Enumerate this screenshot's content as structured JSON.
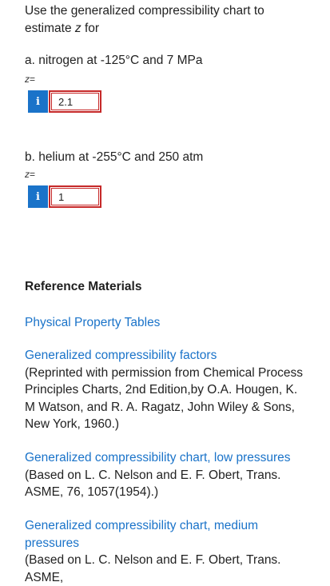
{
  "prompt": {
    "text_before": "Use the generalized compressibility chart to estimate ",
    "var": "z",
    "text_after": " for"
  },
  "parts": [
    {
      "label": "a. nitrogen at -125°C and 7 MPa",
      "z_prefix": "z",
      "z_suffix": "=",
      "info_glyph": "i",
      "info_icon": "info-icon",
      "answer_value": "2.1"
    },
    {
      "label": "b. helium at -255°C and 250 atm",
      "z_prefix": "z",
      "z_suffix": "=",
      "info_glyph": "i",
      "info_icon": "info-icon",
      "answer_value": "1"
    }
  ],
  "colors": {
    "link": "#1a73c9",
    "info_button": "#1a73c9",
    "answer_border": "#c62828"
  },
  "reference": {
    "heading": "Reference Materials",
    "items": [
      {
        "link": "Physical Property Tables",
        "note": ""
      },
      {
        "link": "Generalized compressibility factors",
        "note": "(Reprinted with permission from Chemical Process Principles Charts, 2nd Edition,by O.A. Hougen, K. M Watson, and R. A. Ragatz, John Wiley & Sons, New York, 1960.)"
      },
      {
        "link": "Generalized compressibility chart, low pressures",
        "note": "(Based on L. C. Nelson and E. F. Obert, Trans. ASME, 76, 1057(1954).)"
      },
      {
        "link": "Generalized compressibility chart, medium pressures",
        "note": "(Based on L. C. Nelson and E. F. Obert, Trans. ASME,"
      }
    ]
  }
}
